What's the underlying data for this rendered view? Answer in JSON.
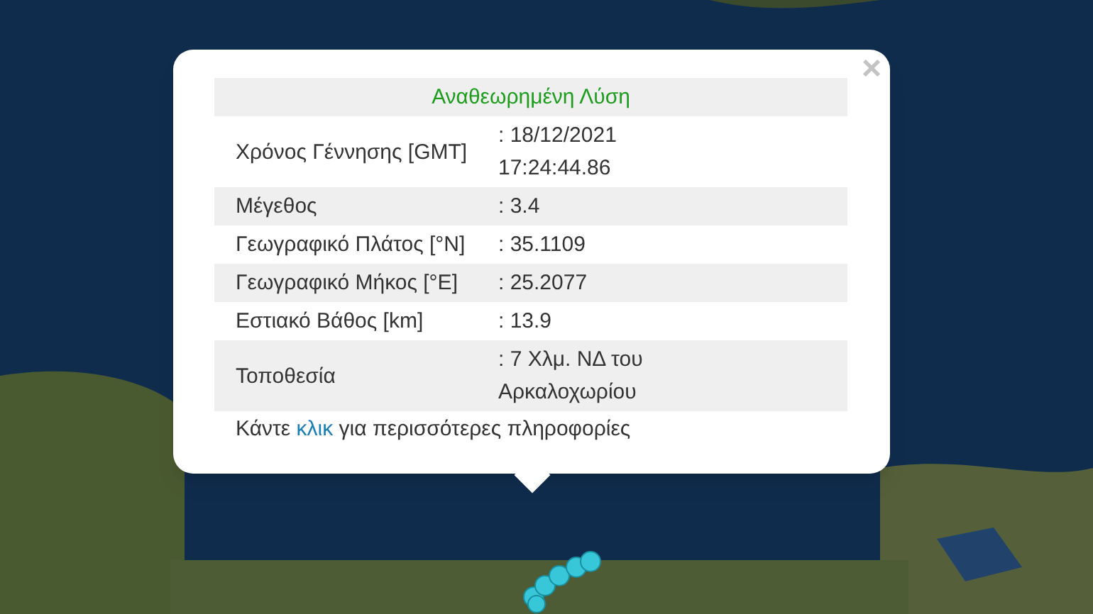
{
  "popup": {
    "close": "×",
    "title": "Αναθεωρημένη Λύση",
    "rows": [
      {
        "label": "Χρόνος Γέννησης [GMT]",
        "value": ": 18/12/2021 17:24:44.86"
      },
      {
        "label": "Μέγεθος",
        "value": ": 3.4"
      },
      {
        "label": "Γεωγραφικό Πλάτος [°N]",
        "value": ": 35.1109"
      },
      {
        "label": "Γεωγραφικό Μήκος [°E]",
        "value": ": 25.2077"
      },
      {
        "label": "Εστιακό Βάθος [km]",
        "value": ": 13.9"
      },
      {
        "label": "Τοποθεσία",
        "value": ": 7 Χλμ. ΝΔ του Αρκαλοχωρίου"
      }
    ],
    "footer": {
      "before": "Κάντε",
      "link": "κλικ",
      "after": "για περισσότερες πληροφορίες"
    }
  }
}
